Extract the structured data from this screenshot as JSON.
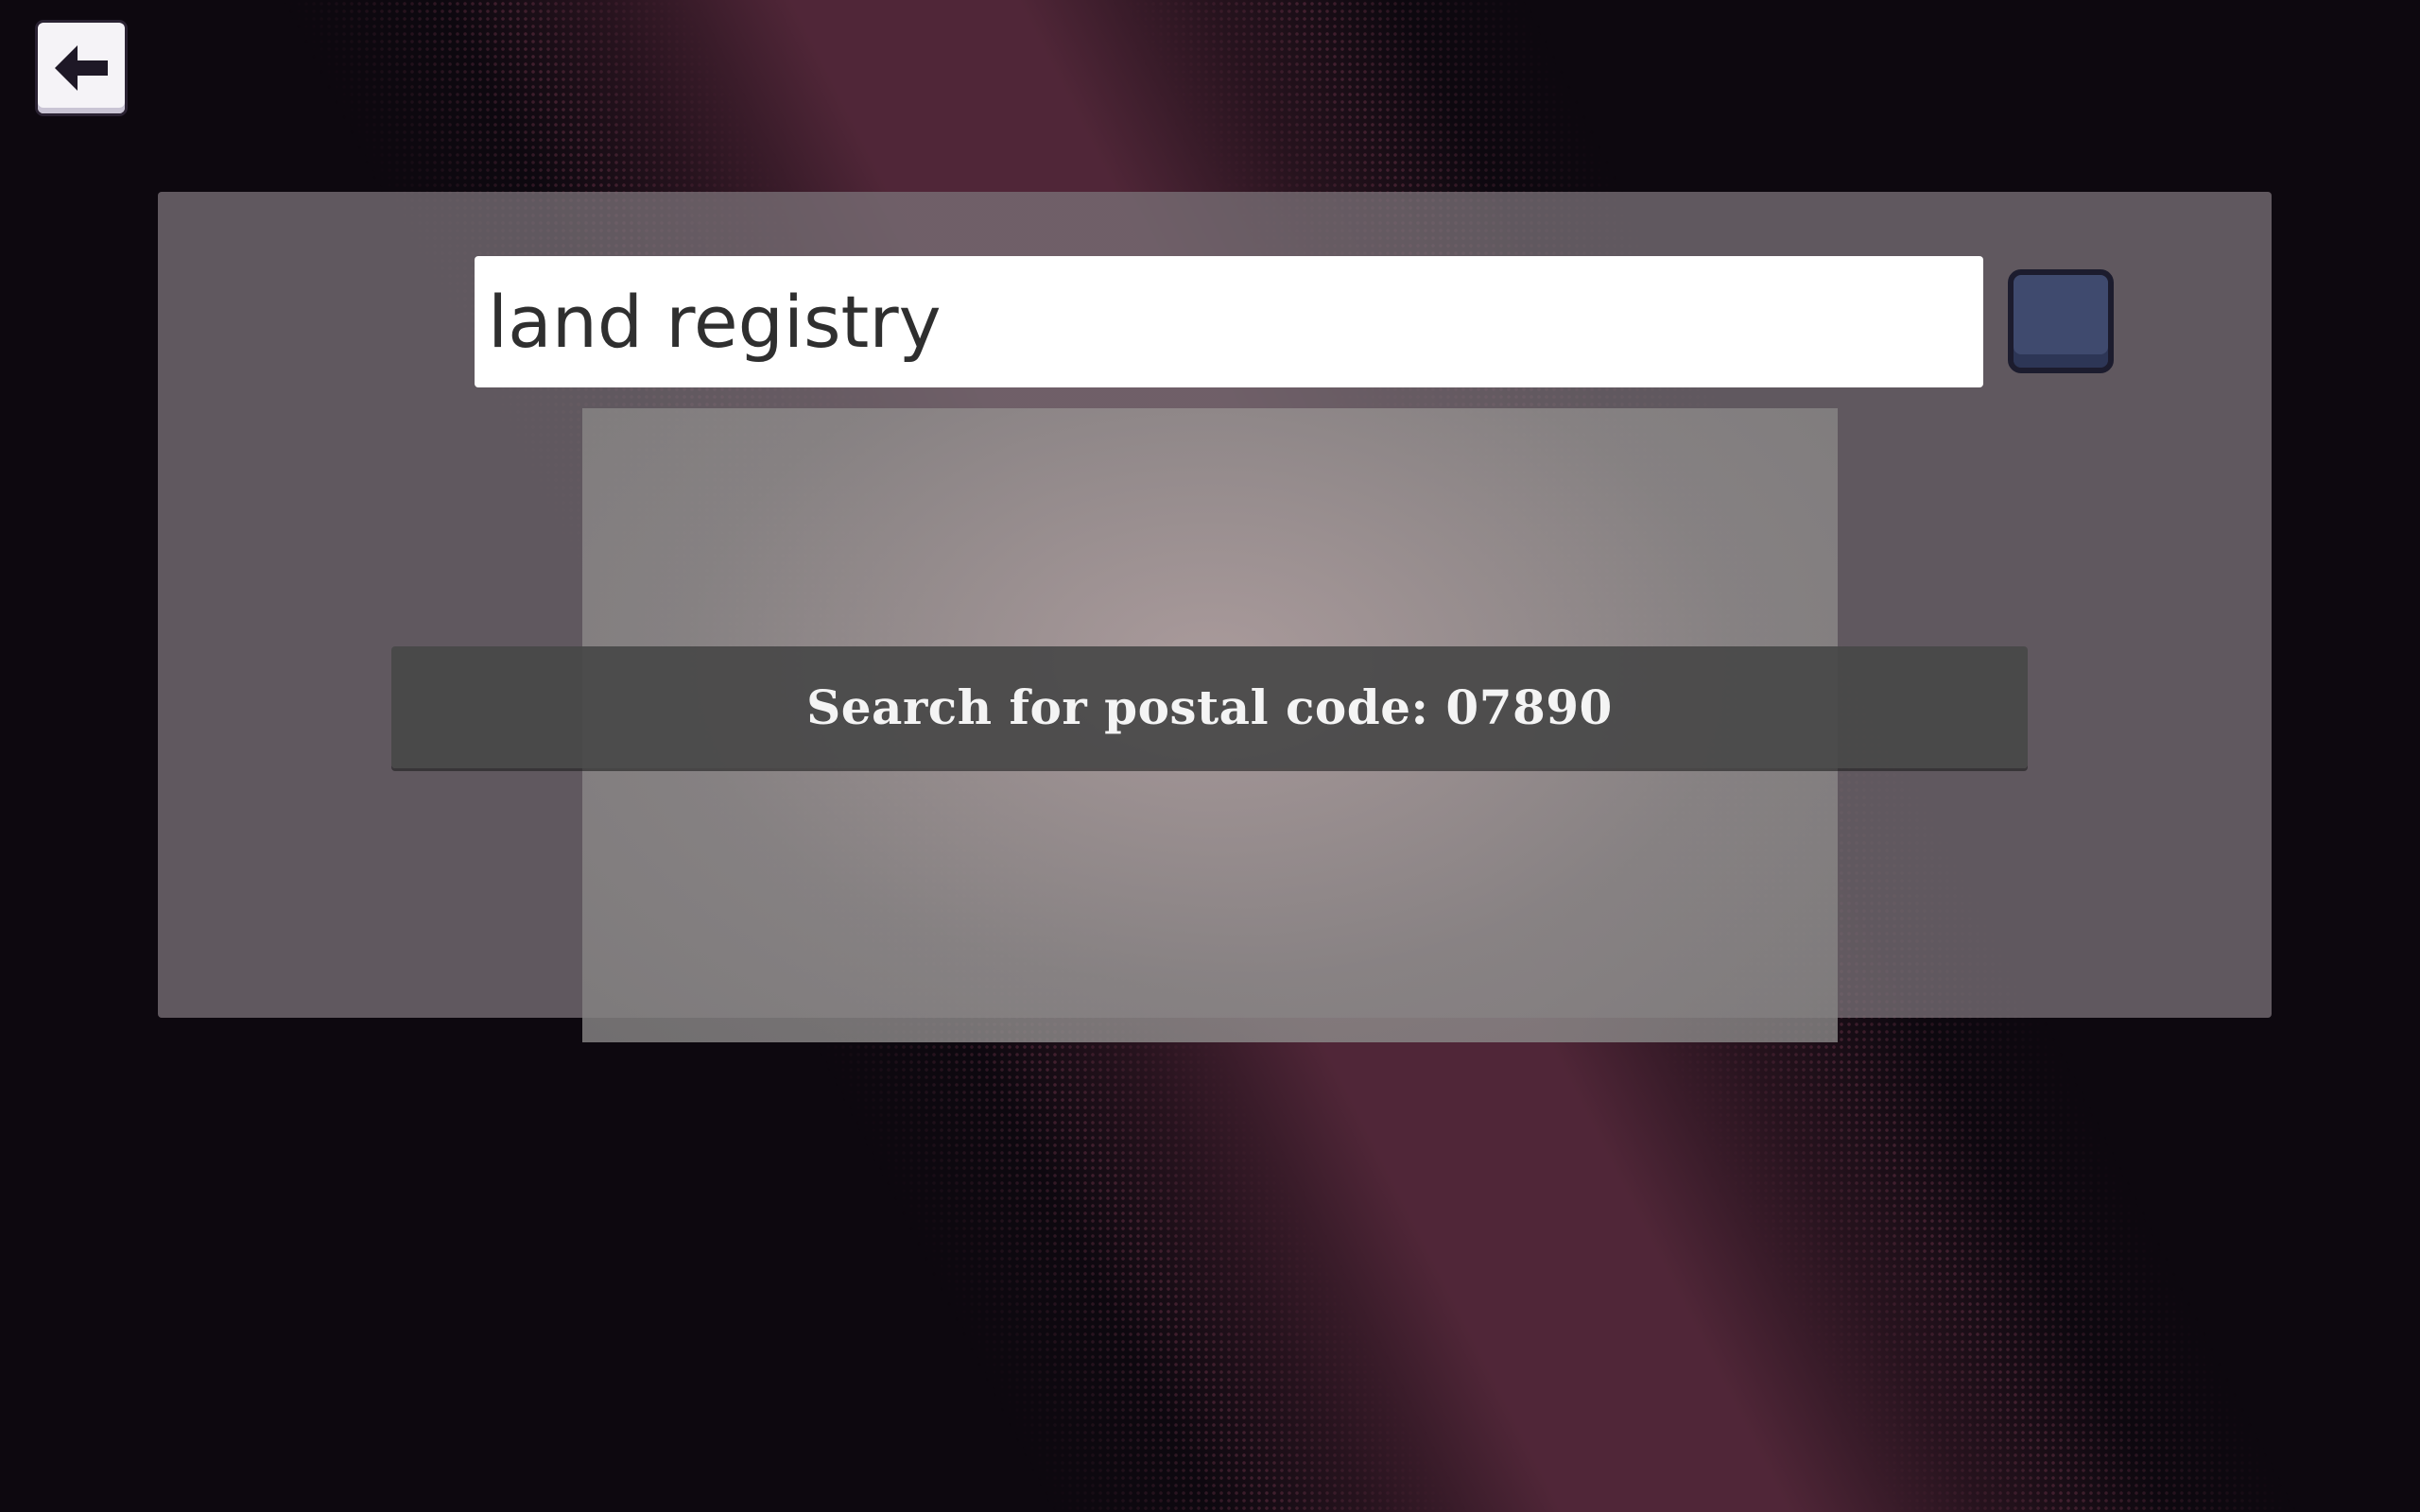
{
  "background": {
    "base_color": "#0d080f",
    "band_color": "#54283a"
  },
  "back_button": {
    "icon": "arrow-left-icon",
    "color": "#f5f3f7"
  },
  "search": {
    "value": "land registry",
    "submit_icon": "square-button",
    "submit_color": "#3f4a6e"
  },
  "results": [
    {
      "label": "Search for postal code: 07890"
    }
  ]
}
